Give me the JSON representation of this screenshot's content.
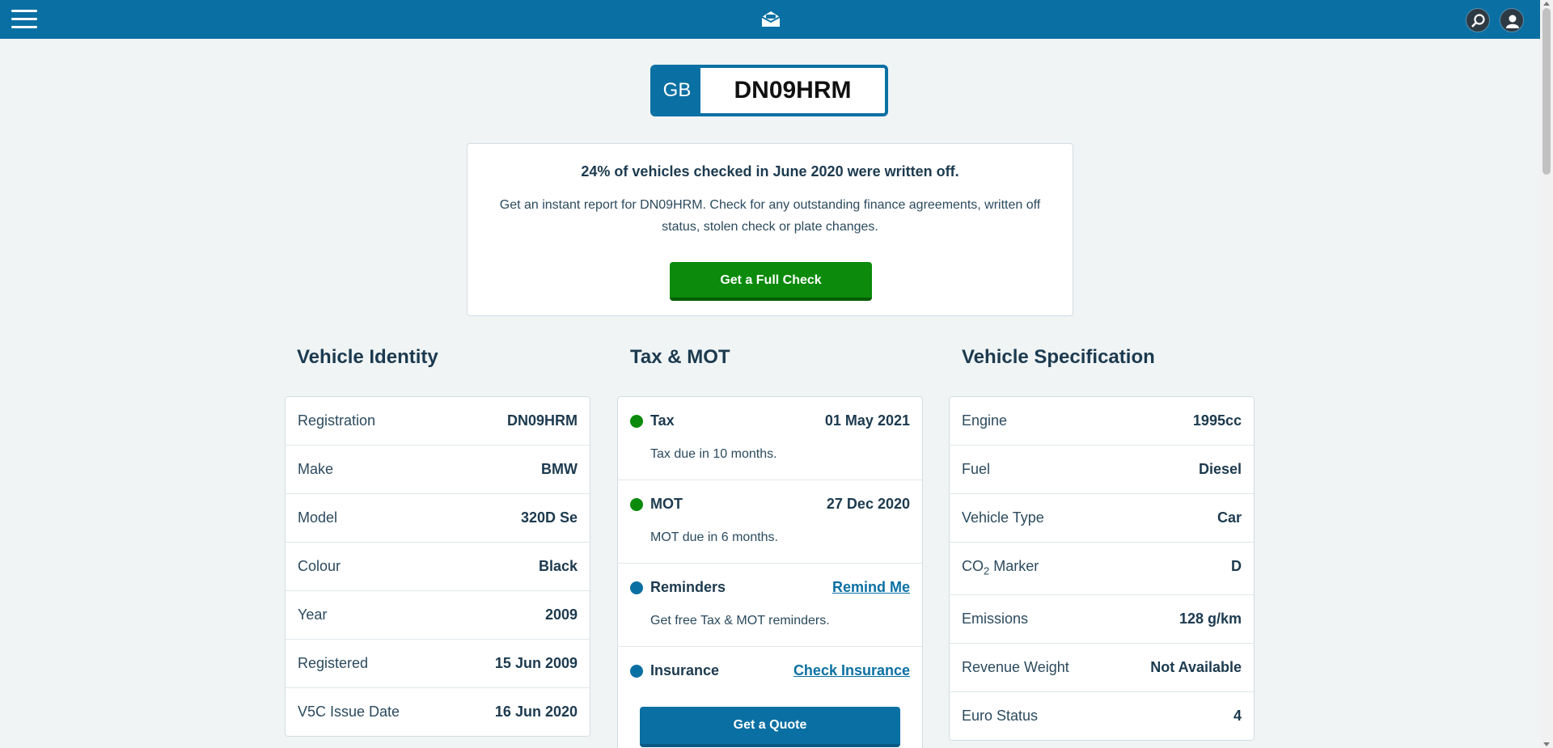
{
  "header": {
    "menu_icon": "hamburger-menu-icon",
    "logo_icon": "car-envelope-logo-icon",
    "search_icon": "search-icon",
    "account_icon": "user-icon"
  },
  "plate": {
    "country": "GB",
    "registration": "DN09HRM"
  },
  "promo": {
    "headline": "24% of vehicles checked in June 2020 were written off.",
    "body": "Get an instant report for DN09HRM. Check for any outstanding finance agreements, written off status, stolen check or plate changes.",
    "button": "Get a Full Check"
  },
  "identity": {
    "title": "Vehicle Identity",
    "rows": [
      {
        "label": "Registration",
        "value": "DN09HRM"
      },
      {
        "label": "Make",
        "value": "BMW"
      },
      {
        "label": "Model",
        "value": "320D Se"
      },
      {
        "label": "Colour",
        "value": "Black"
      },
      {
        "label": "Year",
        "value": "2009"
      },
      {
        "label": "Registered",
        "value": "15 Jun 2009"
      },
      {
        "label": "V5C Issue Date",
        "value": "16 Jun 2020"
      }
    ]
  },
  "taxmot": {
    "title": "Tax & MOT",
    "tax": {
      "label": "Tax",
      "value": "01 May 2021",
      "note": "Tax due in 10 months."
    },
    "mot": {
      "label": "MOT",
      "value": "27 Dec 2020",
      "note": "MOT due in 6 months."
    },
    "reminders": {
      "label": "Reminders",
      "link": "Remind Me",
      "note": "Get free Tax & MOT reminders."
    },
    "insurance": {
      "label": "Insurance",
      "link": "Check Insurance",
      "button": "Get a Quote"
    }
  },
  "spec": {
    "title": "Vehicle Specification",
    "engine": {
      "label": "Engine",
      "value": "1995cc"
    },
    "fuel": {
      "label": "Fuel",
      "value": "Diesel"
    },
    "type": {
      "label": "Vehicle Type",
      "value": "Car"
    },
    "co2": {
      "label_main": "CO",
      "label_sub": "2",
      "label_rest": " Marker",
      "value": "D"
    },
    "emissions": {
      "label": "Emissions",
      "value": "128 g/km"
    },
    "weight": {
      "label": "Revenue Weight",
      "value": "Not Available"
    },
    "euro": {
      "label": "Euro Status",
      "value": "4"
    }
  },
  "colors": {
    "brand": "#0a70a3",
    "green": "#0b8a0b",
    "background": "#f0f4f5"
  }
}
